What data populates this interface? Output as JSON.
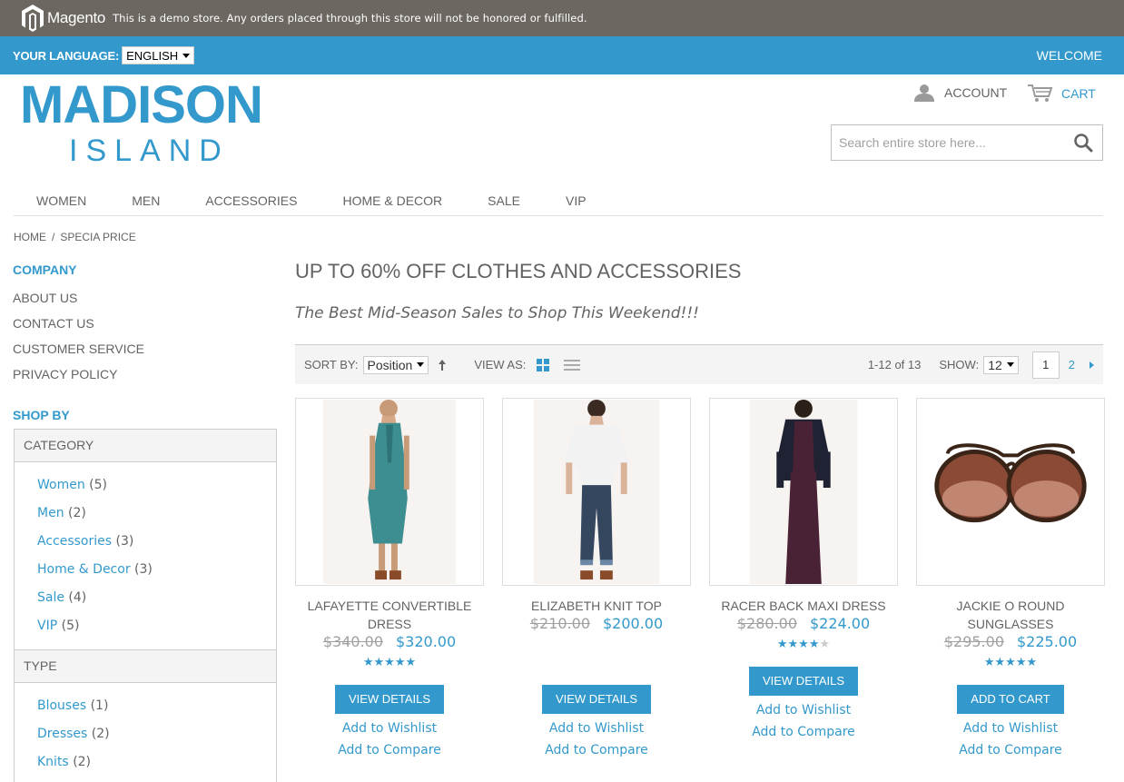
{
  "demo_notice": {
    "logo_text": "Magento",
    "text": "This is a demo store. Any orders placed through this store will not be honored or fulfilled."
  },
  "lang_bar": {
    "label": "YOUR LANGUAGE:",
    "selected": "ENGLISH",
    "welcome": "WELCOME"
  },
  "header": {
    "logo_top": "MADISON",
    "logo_bottom": "ISLAND",
    "account": "ACCOUNT",
    "cart": "CART",
    "search_placeholder": "Search entire store here..."
  },
  "nav": [
    "WOMEN",
    "MEN",
    "ACCESSORIES",
    "HOME & DECOR",
    "SALE",
    "VIP"
  ],
  "breadcrumb": {
    "home": "HOME",
    "sep": "/",
    "current": "SPECIA PRICE"
  },
  "sidebar": {
    "company_title": "COMPANY",
    "company_links": [
      "ABOUT US",
      "CONTACT US",
      "CUSTOMER SERVICE",
      "PRIVACY POLICY"
    ],
    "shopby_title": "SHOP BY",
    "category_title": "CATEGORY",
    "categories": [
      {
        "label": "Women",
        "count": "(5)"
      },
      {
        "label": "Men",
        "count": "(2)"
      },
      {
        "label": "Accessories",
        "count": "(3)"
      },
      {
        "label": "Home & Decor",
        "count": "(3)"
      },
      {
        "label": "Sale",
        "count": "(4)"
      },
      {
        "label": "VIP",
        "count": "(5)"
      }
    ],
    "type_title": "TYPE",
    "types": [
      {
        "label": "Blouses",
        "count": "(1)"
      },
      {
        "label": "Dresses",
        "count": "(2)"
      },
      {
        "label": "Knits",
        "count": "(2)"
      }
    ]
  },
  "main": {
    "title": "UP TO 60% OFF CLOTHES AND ACCESSORIES",
    "subtitle": "The Best Mid-Season Sales to Shop This Weekend!!!"
  },
  "toolbar": {
    "sort_label": "SORT BY:",
    "sort_value": "Position",
    "view_label": "VIEW AS:",
    "amount": "1-12 of 13",
    "show_label": "SHOW:",
    "show_value": "12",
    "page_current": "1",
    "page_next": "2"
  },
  "products": [
    {
      "name": "LAFAYETTE CONVERTIBLE DRESS",
      "old_price": "$340.00",
      "price": "$320.00",
      "rating": 5,
      "button": "VIEW DETAILS",
      "wishlist": "Add to Wishlist",
      "compare": "Add to Compare"
    },
    {
      "name": "ELIZABETH KNIT TOP",
      "old_price": "$210.00",
      "price": "$200.00",
      "rating": 0,
      "button": "VIEW DETAILS",
      "wishlist": "Add to Wishlist",
      "compare": "Add to Compare"
    },
    {
      "name": "RACER BACK MAXI DRESS",
      "old_price": "$280.00",
      "price": "$224.00",
      "rating": 4,
      "button": "VIEW DETAILS",
      "wishlist": "Add to Wishlist",
      "compare": "Add to Compare"
    },
    {
      "name": "JACKIE O ROUND SUNGLASSES",
      "old_price": "$295.00",
      "price": "$225.00",
      "rating": 5,
      "button": "ADD TO CART",
      "wishlist": "Add to Wishlist",
      "compare": "Add to Compare"
    }
  ],
  "colors": {
    "accent": "#3399cc",
    "demo_bar": "#6c6760",
    "text": "#636363"
  }
}
